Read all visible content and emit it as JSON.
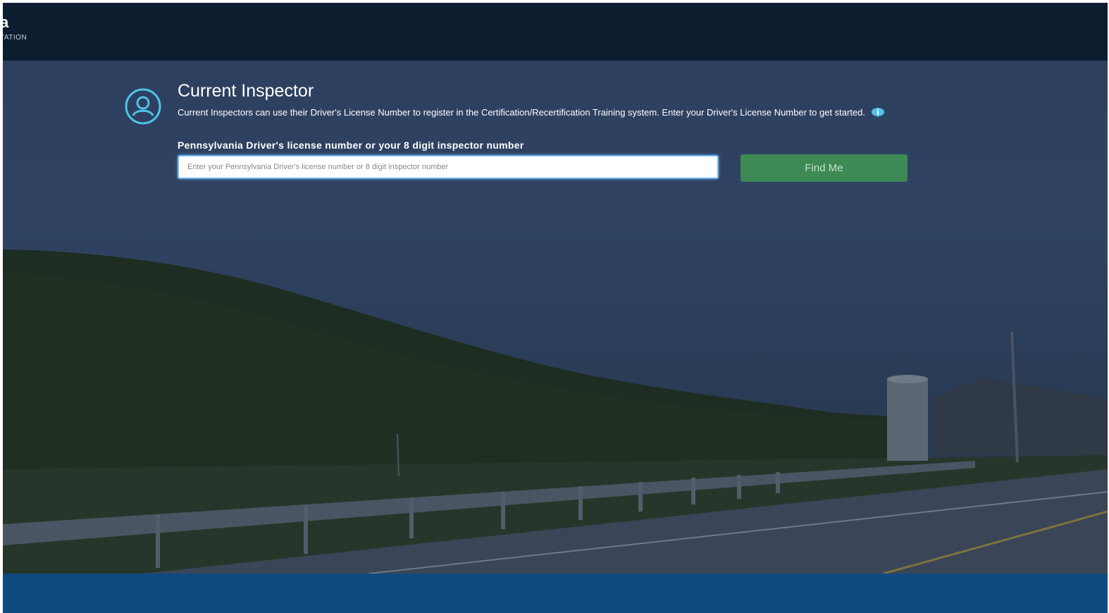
{
  "header": {
    "logo_letter": "a",
    "logo_subtext": "TATION"
  },
  "inspector": {
    "title": "Current Inspector",
    "description": "Current Inspectors can use their Driver's License Number to register in the Certification/Recertification Training system. Enter your Driver's License Number to get started.",
    "field_label": "Pennsylvania Driver's license number or your 8 digit inspector number",
    "input_value": "",
    "input_placeholder": "Enter your Pennsylvania Driver's license number or 8 digit inspector number",
    "button_label": "Find Me"
  },
  "icons": {
    "user": "user-circle-icon",
    "info": "info-bubble-icon"
  },
  "colors": {
    "header_bg": "#0d1d30",
    "overlay": "#2e4060",
    "button_bg": "#3e8a55",
    "footer_bg": "#0f4a80",
    "accent": "#4fc3e8"
  }
}
